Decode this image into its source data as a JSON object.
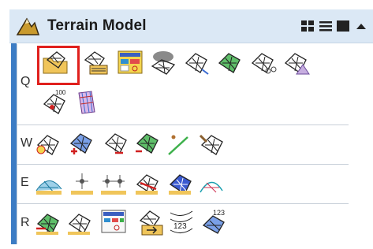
{
  "header": {
    "title": "Terrain Model",
    "buttons": [
      "grid-view-icon",
      "list-view-icon",
      "ribbon-view-icon",
      "collapse-icon"
    ]
  },
  "rows": [
    {
      "label": "Q",
      "icons": [
        "open-terrain-icon",
        "from-file-icon",
        "from-graphics-icon",
        "cloud-terrain-icon",
        "terrain-filter-icon",
        "terrain-color-icon",
        "clip-terrain-icon",
        "terrain-mesh-icon",
        "terrain-100-icon",
        "terrain-surface-icon"
      ]
    },
    {
      "label": "W",
      "icons": [
        "add-feature-icon",
        "add-point-icon",
        "delete-feature-icon",
        "edit-feature-icon",
        "draw-line-icon",
        "terrain-tools-icon"
      ]
    },
    {
      "label": "E",
      "icons": [
        "profile-icon",
        "point-spot-icon",
        "two-spot-icon",
        "terrain-red-icon",
        "terrain-blue-icon",
        "mesh-wave-icon"
      ]
    },
    {
      "label": "R",
      "icons": [
        "terrain-move-icon",
        "terrain-grid-icon",
        "report-icon",
        "export-icon",
        "contours-123-icon",
        "elevation-123-icon"
      ]
    }
  ],
  "colors": {
    "header_bg": "#dbe8f5",
    "accent_bar": "#3c7cc4",
    "selection": "#e0201d"
  }
}
